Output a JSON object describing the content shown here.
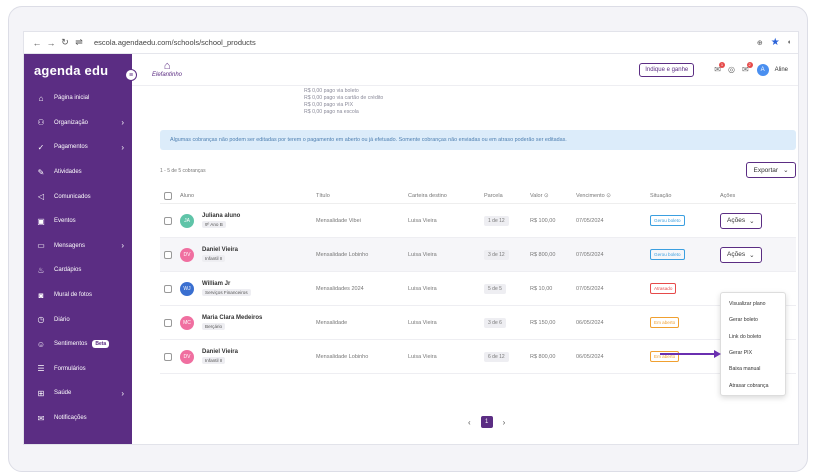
{
  "browser": {
    "url": "escola.agendaedu.com/schools/school_products"
  },
  "sidebar": {
    "brand": "agenda edu",
    "items": [
      {
        "label": "Página inicial",
        "icon": "home-icon",
        "glyph": "⌂",
        "chevron": false
      },
      {
        "label": "Organização",
        "icon": "org-icon",
        "glyph": "⚇",
        "chevron": true
      },
      {
        "label": "Pagamentos",
        "icon": "payments-icon",
        "glyph": "✓",
        "chevron": true
      },
      {
        "label": "Atividades",
        "icon": "pencil-icon",
        "glyph": "✎",
        "chevron": false
      },
      {
        "label": "Comunicados",
        "icon": "megaphone-icon",
        "glyph": "◁",
        "chevron": false
      },
      {
        "label": "Eventos",
        "icon": "calendar-icon",
        "glyph": "▣",
        "chevron": false
      },
      {
        "label": "Mensagens",
        "icon": "message-icon",
        "glyph": "▭",
        "chevron": true
      },
      {
        "label": "Cardápios",
        "icon": "menu-icon",
        "glyph": "♨",
        "chevron": false
      },
      {
        "label": "Mural de fotos",
        "icon": "camera-icon",
        "glyph": "◙",
        "chevron": false
      },
      {
        "label": "Diário",
        "icon": "clock-icon",
        "glyph": "◷",
        "chevron": false
      },
      {
        "label": "Sentimentos",
        "icon": "chat-icon",
        "glyph": "☺",
        "chevron": false,
        "badge": "Beta"
      },
      {
        "label": "Formulários",
        "icon": "list-icon",
        "glyph": "☰",
        "chevron": false
      },
      {
        "label": "Saúde",
        "icon": "health-icon",
        "glyph": "⊞",
        "chevron": true
      },
      {
        "label": "Notificações",
        "icon": "bell-icon",
        "glyph": "✉",
        "chevron": false
      }
    ]
  },
  "topbar": {
    "school_name": "Elefantinho",
    "indique": "Indique e ganhe",
    "user": "Aline",
    "user_initial": "A"
  },
  "payments_summary": [
    "R$ 0,00 pago via boleto",
    "R$ 0,00 pago via cartão de crédito",
    "R$ 0,00 pago via PIX",
    "R$ 0,00 pago na escola"
  ],
  "alert": "Algumas cobranças não podem ser editadas por terem o pagamento em aberto ou já efetuado. Somente cobranças não enviadas ou em atraso poderão ser editadas.",
  "count_label": "1 - 5 de 5 cobranças",
  "export_label": "Exportar",
  "table": {
    "headers": [
      "Aluno",
      "Título",
      "Carteira destino",
      "Parcela",
      "Valor",
      "Vencimento",
      "Situação",
      "Ações"
    ],
    "rows": [
      {
        "initials": "JA",
        "avatar_color": "#5fc4a8",
        "name": "Juliana aluno",
        "class": "9º Ano B",
        "title": "Mensalidade Vibei",
        "wallet": "Luisa Vieira",
        "installment": "1 de 12",
        "value": "R$ 100,00",
        "due": "07/05/2024",
        "status": "Gerou boleto",
        "status_color": "#3b9fe0",
        "action": "Ações"
      },
      {
        "initials": "DV",
        "avatar_color": "#f06fa0",
        "name": "Daniel Vieira",
        "class": "Infantil II",
        "title": "Mensalidade Lobinho",
        "wallet": "Luisa Vieira",
        "installment": "3 de 12",
        "value": "R$ 800,00",
        "due": "07/05/2024",
        "status": "Gerou boleto",
        "status_color": "#3b9fe0",
        "action": "Ações"
      },
      {
        "initials": "WJ",
        "avatar_color": "#3a6fd0",
        "name": "William Jr",
        "class": "Serviços Financeiros",
        "title": "Mensalidades 2024",
        "wallet": "Luisa Vieira",
        "installment": "5 de 5",
        "value": "R$ 10,00",
        "due": "07/05/2024",
        "status": "Atrasado",
        "status_color": "#e64a4a",
        "action": "Ações"
      },
      {
        "initials": "MC",
        "avatar_color": "#f06fa0",
        "name": "Maria Clara Medeiros",
        "class": "Berçário",
        "title": "Mensalidade",
        "wallet": "Luisa Vieira",
        "installment": "3 de 6",
        "value": "R$ 150,00",
        "due": "06/05/2024",
        "status": "Em aberto",
        "status_color": "#f0a030",
        "action": "Ações"
      },
      {
        "initials": "DV",
        "avatar_color": "#f06fa0",
        "name": "Daniel Vieira",
        "class": "Infantil II",
        "title": "Mensalidade Lobinho",
        "wallet": "Luisa Vieira",
        "installment": "6 de 12",
        "value": "R$ 800,00",
        "due": "06/05/2024",
        "status": "Em aberto",
        "status_color": "#f0a030",
        "action": "Ações"
      }
    ]
  },
  "dropdown": [
    "Visualizar plano",
    "Gerar boleto",
    "Link do boleto",
    "Gerar PIX",
    "Baixa manual",
    "Atrasar cobrança"
  ],
  "pager": {
    "current": "1"
  },
  "colors": {
    "brand": "#5b2d83",
    "alert_bg": "#dcecfa"
  }
}
